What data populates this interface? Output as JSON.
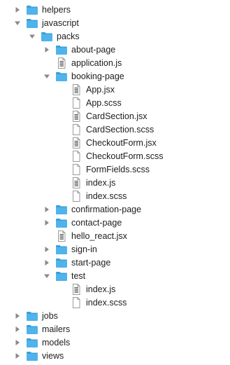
{
  "file_tree": {
    "items": [
      {
        "name": "helpers",
        "type": "folder",
        "expanded": false,
        "depth": 0,
        "icon": "folder-icon"
      },
      {
        "name": "javascript",
        "type": "folder",
        "expanded": true,
        "depth": 0,
        "icon": "folder-icon"
      },
      {
        "name": "packs",
        "type": "folder",
        "expanded": true,
        "depth": 1,
        "icon": "folder-icon"
      },
      {
        "name": "about-page",
        "type": "folder",
        "expanded": false,
        "depth": 2,
        "icon": "folder-icon"
      },
      {
        "name": "application.js",
        "type": "file",
        "depth": 2,
        "icon": "js-file-icon"
      },
      {
        "name": "booking-page",
        "type": "folder",
        "expanded": true,
        "depth": 2,
        "icon": "folder-icon"
      },
      {
        "name": "App.jsx",
        "type": "file",
        "depth": 3,
        "icon": "js-file-icon"
      },
      {
        "name": "App.scss",
        "type": "file",
        "depth": 3,
        "icon": "file-icon"
      },
      {
        "name": "CardSection.jsx",
        "type": "file",
        "depth": 3,
        "icon": "js-file-icon"
      },
      {
        "name": "CardSection.scss",
        "type": "file",
        "depth": 3,
        "icon": "file-icon"
      },
      {
        "name": "CheckoutForm.jsx",
        "type": "file",
        "depth": 3,
        "icon": "js-file-icon"
      },
      {
        "name": "CheckoutForm.scss",
        "type": "file",
        "depth": 3,
        "icon": "file-icon"
      },
      {
        "name": "FormFields.scss",
        "type": "file",
        "depth": 3,
        "icon": "file-icon"
      },
      {
        "name": "index.js",
        "type": "file",
        "depth": 3,
        "icon": "js-file-icon"
      },
      {
        "name": "index.scss",
        "type": "file",
        "depth": 3,
        "icon": "file-icon"
      },
      {
        "name": "confirmation-page",
        "type": "folder",
        "expanded": false,
        "depth": 2,
        "icon": "folder-icon"
      },
      {
        "name": "contact-page",
        "type": "folder",
        "expanded": false,
        "depth": 2,
        "icon": "folder-icon"
      },
      {
        "name": "hello_react.jsx",
        "type": "file",
        "depth": 2,
        "icon": "js-file-icon"
      },
      {
        "name": "sign-in",
        "type": "folder",
        "expanded": false,
        "depth": 2,
        "icon": "folder-icon"
      },
      {
        "name": "start-page",
        "type": "folder",
        "expanded": false,
        "depth": 2,
        "icon": "folder-icon"
      },
      {
        "name": "test",
        "type": "folder",
        "expanded": true,
        "depth": 2,
        "icon": "folder-icon"
      },
      {
        "name": "index.js",
        "type": "file",
        "depth": 3,
        "icon": "js-file-icon"
      },
      {
        "name": "index.scss",
        "type": "file",
        "depth": 3,
        "icon": "file-icon"
      },
      {
        "name": "jobs",
        "type": "folder",
        "expanded": false,
        "depth": 0,
        "icon": "folder-icon"
      },
      {
        "name": "mailers",
        "type": "folder",
        "expanded": false,
        "depth": 0,
        "icon": "folder-icon"
      },
      {
        "name": "models",
        "type": "folder",
        "expanded": false,
        "depth": 0,
        "icon": "folder-icon"
      },
      {
        "name": "views",
        "type": "folder",
        "expanded": false,
        "depth": 0,
        "icon": "folder-icon"
      }
    ]
  },
  "colors": {
    "folder_body": "#4fb3ec",
    "folder_tab": "#3d9fd8",
    "disclosure": "#8a8a8a",
    "text": "#1d1d1d",
    "file_outline": "#9a9a9a",
    "js_file_mark": "#555555"
  }
}
